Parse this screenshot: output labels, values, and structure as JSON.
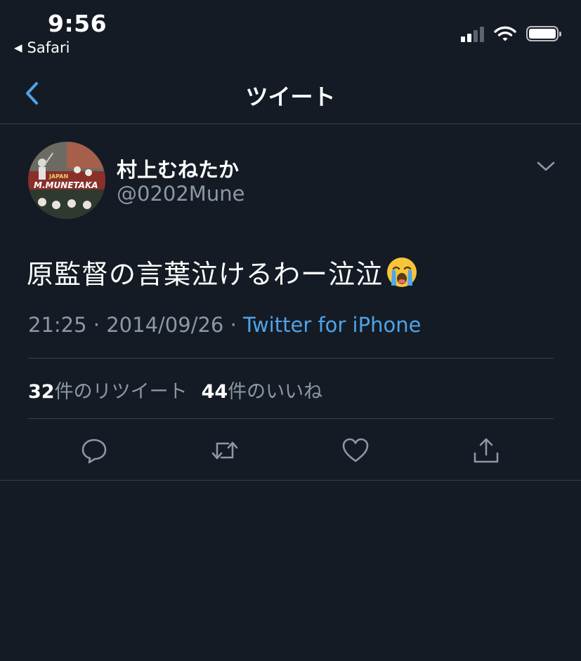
{
  "status_bar": {
    "time": "9:56",
    "back_app": "Safari",
    "signal_icon": "cellular-signal-icon",
    "wifi_icon": "wifi-icon",
    "battery_icon": "battery-icon"
  },
  "nav": {
    "title": "ツイート",
    "back_icon": "chevron-left-icon"
  },
  "tweet": {
    "author_name": "村上むねたか",
    "author_handle": "@0202Mune",
    "avatar_text": "M.MUNETAKA",
    "avatar_text_top": "JAPAN",
    "text": "原監督の言葉泣けるわー泣泣",
    "emoji": "loudly-crying-face-emoji",
    "time": "21:25",
    "date": "2014/09/26",
    "separator": " · ",
    "source": "Twitter for iPhone",
    "retweets": {
      "count": "32",
      "label": "件のリツイート"
    },
    "likes": {
      "count": "44",
      "label": "件のいいね"
    }
  },
  "actions": [
    {
      "name": "reply-icon"
    },
    {
      "name": "retweet-icon"
    },
    {
      "name": "like-icon"
    },
    {
      "name": "share-icon"
    }
  ],
  "colors": {
    "background": "#141b24",
    "divider": "#38414c",
    "secondary_text": "#8b98a5",
    "link": "#4fa3e8"
  }
}
